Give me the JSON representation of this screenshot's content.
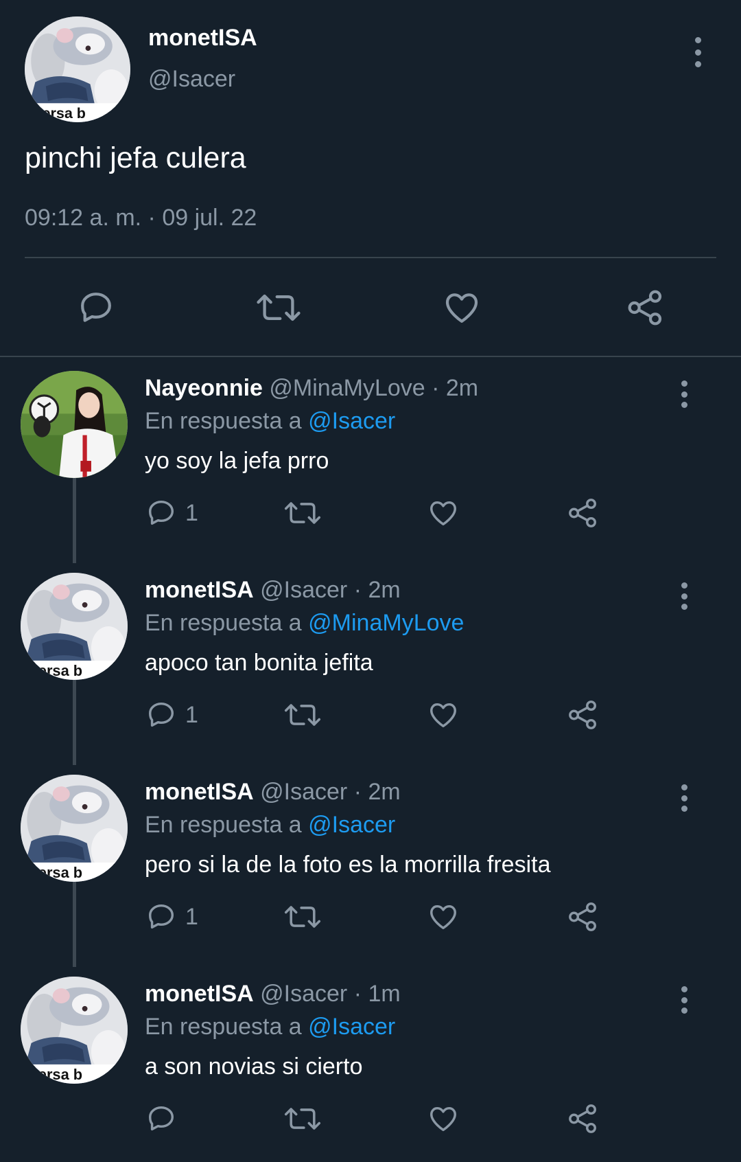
{
  "main_tweet": {
    "display_name": "monetISA",
    "handle": "@Isacer",
    "avatar_icon": "rat-avatar",
    "text": "pinchi jefa culera",
    "timestamp": "09:12 a. m. · 09 jul. 22",
    "actions": {
      "reply_icon": "reply-icon",
      "retweet_icon": "retweet-icon",
      "like_icon": "heart-icon",
      "share_icon": "share-icon"
    }
  },
  "replies": [
    {
      "display_name": "Nayeonnie",
      "handle_time": "@MinaMyLove · 2m",
      "reply_prefix": "En respuesta a",
      "reply_to": "@Isacer",
      "text": "yo soy la jefa prro",
      "reply_count": "1",
      "avatar_icon": "girl-soccer-avatar"
    },
    {
      "display_name": "monetISA",
      "handle_time": "@Isacer · 2m",
      "reply_prefix": "En respuesta a",
      "reply_to": "@MinaMyLove",
      "text": "apoco tan bonita jefita",
      "reply_count": "1",
      "avatar_icon": "rat-avatar"
    },
    {
      "display_name": "monetISA",
      "handle_time": "@Isacer · 2m",
      "reply_prefix": "En respuesta a",
      "reply_to": "@Isacer",
      "text": "pero si la de la foto es la morrilla fresita",
      "reply_count": "1",
      "avatar_icon": "rat-avatar"
    },
    {
      "display_name": "monetISA",
      "handle_time": "@Isacer · 1m",
      "reply_prefix": "En respuesta a",
      "reply_to": "@Isacer",
      "text": "a son novias si cierto",
      "reply_count": "",
      "avatar_icon": "rat-avatar"
    }
  ],
  "colors": {
    "background": "#15202b",
    "secondary_text": "#8b98a5",
    "link": "#1d9bf0",
    "divider": "#38444d"
  }
}
